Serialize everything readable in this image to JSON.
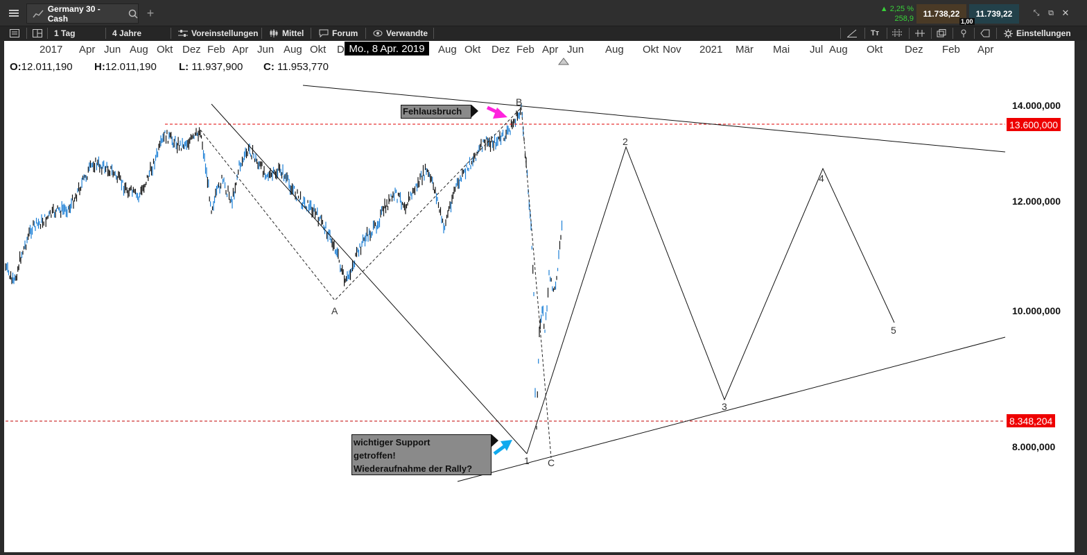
{
  "window": {
    "tab_title": "Germany 30 - Cash",
    "change_pct": "▲ 2,25 %",
    "change_pts": "258,9",
    "sell_price": "11.738,22",
    "buy_price": "11.739,22",
    "spread": "1,00"
  },
  "toolbar": {
    "interval": "1 Tag",
    "range": "4 Jahre",
    "presets": "Voreinstellungen",
    "chart_type": "Mittel",
    "forum": "Forum",
    "related": "Verwandte",
    "settings": "Einstellungen"
  },
  "xaxis": {
    "labels": [
      "2017",
      "Apr",
      "Jun",
      "Aug",
      "Okt",
      "Dez",
      "Feb",
      "Apr",
      "Jun",
      "Aug",
      "Okt",
      "D",
      "Aug",
      "Okt",
      "Dez",
      "Feb",
      "Apr",
      "Jun",
      "Aug",
      "Okt",
      "Nov",
      "2021",
      "Mär",
      "Mai",
      "Jul",
      "Aug",
      "Okt",
      "Dez",
      "Feb",
      "Apr"
    ],
    "hover_date": "Mo., 8 Apr. 2019"
  },
  "ohlc": {
    "o_label": "O:",
    "o": "12.011,190",
    "h_label": "H:",
    "h": "12.011,190",
    "l_label": "L:",
    "l": "11.937,900",
    "c_label": "C:",
    "c": "11.953,770"
  },
  "yaxis": {
    "labels": [
      "14.000,000",
      "12.000,000",
      "10.000,000",
      "8.000,000"
    ],
    "resistance_tag": "13.600,000",
    "support_tag": "8.348,204"
  },
  "annotations": {
    "false_breakout": "Fehlausbruch",
    "support_line1": "wichtiger Support",
    "support_line2": "getroffen!",
    "support_line3": "Wiederaufnahme der Rally?",
    "wave_A": "A",
    "wave_B": "B",
    "wave_C": "C",
    "wave_1": "1",
    "wave_2": "2",
    "wave_3": "3",
    "wave_4": "4",
    "wave_5": "5"
  },
  "colors": {
    "up": "#1b7fd6",
    "down": "#111111",
    "resistance": "#e00000",
    "arrow_magenta": "#ff22dd",
    "arrow_cyan": "#11aaee"
  }
}
